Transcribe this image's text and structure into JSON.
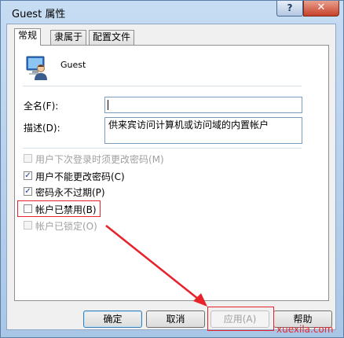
{
  "window": {
    "title": "Guest 属性",
    "help_label": "?",
    "close_label": "✕"
  },
  "tabs": [
    {
      "label": "常规",
      "active": true
    },
    {
      "label": "隶属于",
      "active": false
    },
    {
      "label": "配置文件",
      "active": false
    }
  ],
  "user": {
    "name": "Guest",
    "icon": "user-account-icon"
  },
  "fields": {
    "fullname_label": "全名(F):",
    "fullname_value": "",
    "description_label": "描述(D):",
    "description_value": "供来宾访问计算机或访问域的内置帐户"
  },
  "checkboxes": [
    {
      "label": "用户下次登录时须更改密码(M)",
      "checked": false,
      "enabled": false
    },
    {
      "label": "用户不能更改密码(C)",
      "checked": true,
      "enabled": true
    },
    {
      "label": "密码永不过期(P)",
      "checked": true,
      "enabled": true
    },
    {
      "label": "帐户已禁用(B)",
      "checked": false,
      "enabled": true
    },
    {
      "label": "帐户已锁定(O)",
      "checked": false,
      "enabled": false
    }
  ],
  "buttons": {
    "ok": "确定",
    "cancel": "取消",
    "apply": "应用(A)",
    "help": "帮助"
  },
  "watermark": "xuexila.com",
  "colors": {
    "annotation": "#e8222b",
    "frame": "#b9d1ea"
  }
}
